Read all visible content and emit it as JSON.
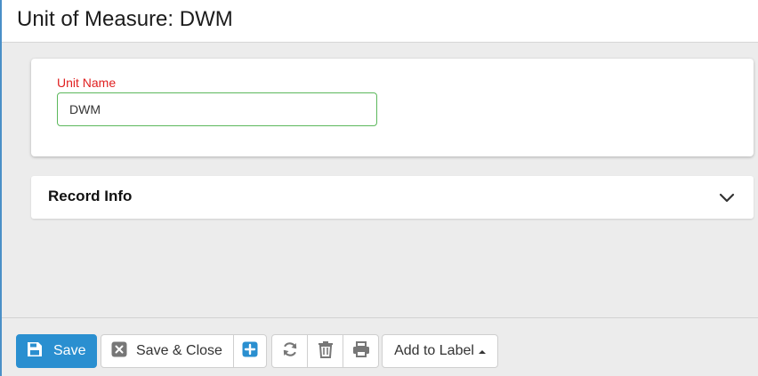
{
  "header": {
    "title": "Unit of Measure: DWM"
  },
  "form": {
    "unit_name_label": "Unit Name",
    "unit_name_value": "DWM"
  },
  "record_info": {
    "title": "Record Info",
    "icon": "chevron-down-icon"
  },
  "toolbar": {
    "save_label": "Save",
    "save_close_label": "Save & Close",
    "add_to_label_label": "Add to Label",
    "icons": {
      "save": "floppy-disk-icon",
      "save_close": "close-box-icon",
      "add": "plus-box-icon",
      "refresh": "refresh-icon",
      "delete": "trash-icon",
      "print": "printer-icon"
    }
  },
  "colors": {
    "accent": "#2a8fd0",
    "required_label": "#e02020",
    "valid_border": "#5cb85c",
    "icon_gray": "#777777"
  }
}
